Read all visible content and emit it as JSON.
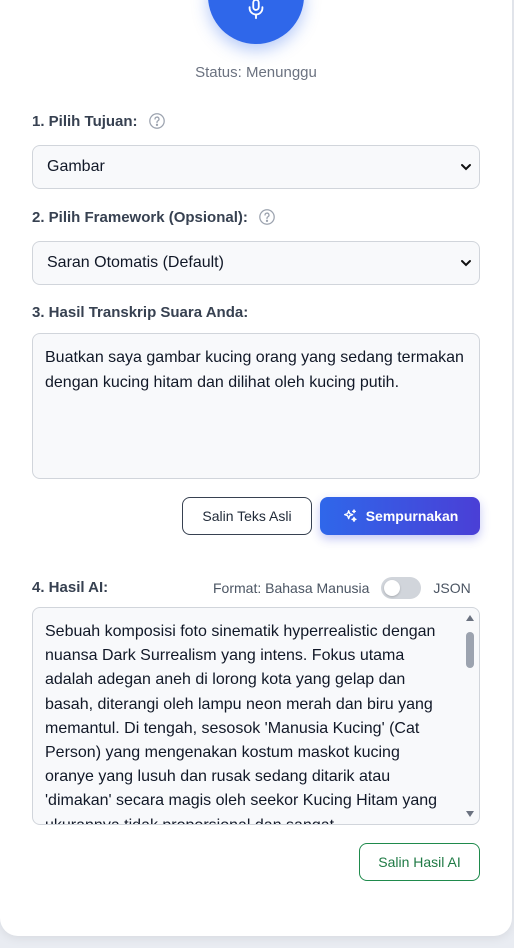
{
  "status": {
    "text": "Status: Menunggu"
  },
  "step1": {
    "label": "1. Pilih Tujuan:",
    "selected": "Gambar"
  },
  "step2": {
    "label": "2. Pilih Framework (Opsional):",
    "selected": "Saran Otomatis (Default)"
  },
  "step3": {
    "label": "3. Hasil Transkrip Suara Anda:",
    "transcript": "Buatkan saya gambar kucing orang yang sedang termakan dengan kucing hitam dan dilihat oleh kucing putih."
  },
  "actions": {
    "copy_original": "Salin Teks Asli",
    "refine": "Sempurnakan"
  },
  "step4": {
    "label": "4. Hasil AI:",
    "format_label": "Format: Bahasa Manusia",
    "format_alt": "JSON",
    "json_toggle_on": false,
    "result": "Sebuah komposisi foto sinematik hyperrealistic dengan nuansa Dark Surrealism yang intens. Fokus utama adalah adegan aneh di lorong kota yang gelap dan basah, diterangi oleh lampu neon merah dan biru yang memantul. Di tengah, sesosok 'Manusia Kucing' (Cat Person) yang mengenakan kostum maskot kucing oranye yang lusuh dan rusak sedang ditarik atau 'dimakan' secara magis oleh seekor Kucing Hitam yang ukurannya tidak proporsional dan sangat",
    "copy_result": "Salin Hasil AI"
  },
  "colors": {
    "primary": "#2f67ea",
    "accent_gradient_end": "#4a3fd6",
    "success": "#1f8a4c"
  }
}
